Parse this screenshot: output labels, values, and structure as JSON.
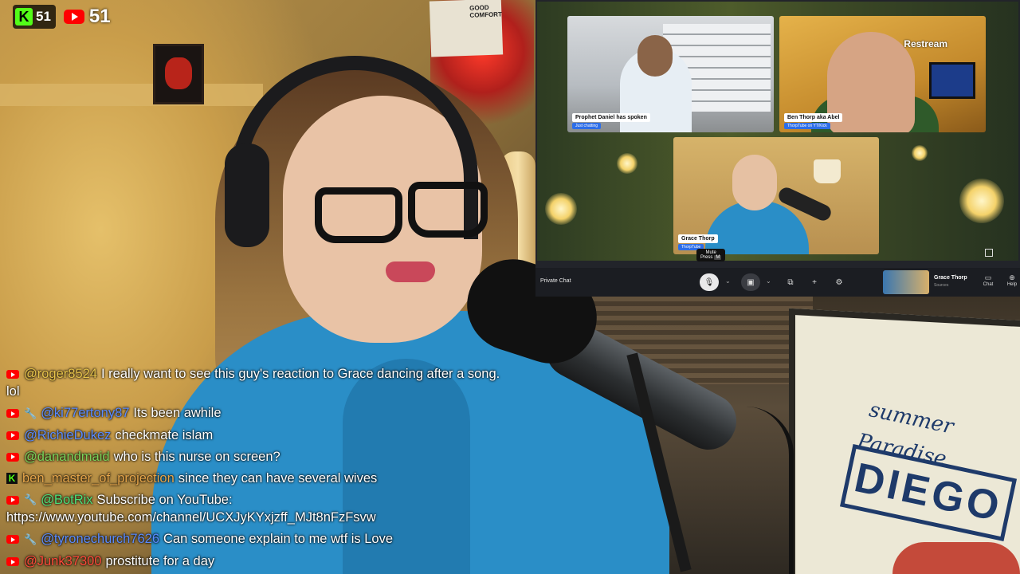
{
  "counters": {
    "kick": "51",
    "youtube": "51"
  },
  "colors": {
    "kick_green": "#53fc18",
    "youtube_red": "#ff0000",
    "hoodie": "#2a8ec7",
    "restream_bg": "#22242a"
  },
  "restream": {
    "logo": "Restream",
    "participants": [
      {
        "name": "Prophet Daniel has spoken",
        "sub": "Just chatting"
      },
      {
        "name": "Ben Thorp aka Abel",
        "sub": "ThorpTube on YT/Kick"
      },
      {
        "name": "Grace Thorp",
        "sub": "ThorpTube"
      }
    ],
    "tooltip": {
      "title": "Mute",
      "press": "Press",
      "key": "M"
    },
    "toolbar": {
      "private_chat": "Private Chat",
      "profile_name": "Grace Thorp",
      "profile_sub": "Sources",
      "chat_label": "Chat",
      "help_label": "Help"
    }
  },
  "sign": {
    "line1": "summer",
    "line2": "Paradise",
    "main": "DIEGO"
  },
  "chat": [
    {
      "platform": "youtube",
      "mod": false,
      "user": "@roger8524",
      "user_color": "#e7c34a",
      "text": "I really want to see this guy's reaction to Grace dancing after a song. lol"
    },
    {
      "platform": "youtube",
      "mod": true,
      "user": "@ki77ertony87",
      "user_color": "#5b8cff",
      "text": "Its been awhile"
    },
    {
      "platform": "youtube",
      "mod": false,
      "user": "@RichieDukez",
      "user_color": "#5b8cff",
      "text": "checkmate islam"
    },
    {
      "platform": "youtube",
      "mod": false,
      "user": "@danandmaid",
      "user_color": "#7ad35a",
      "text": "who is this nurse on screen?"
    },
    {
      "platform": "kick",
      "mod": false,
      "user": "ben_master_of_projection",
      "user_color": "#e7a64a",
      "text": "since they can have several wives"
    },
    {
      "platform": "youtube",
      "mod": true,
      "user": "@BotRix",
      "user_color": "#4de07a",
      "text": "Subscribe on YouTube: https://www.youtube.com/channel/UCXJyKYxjzff_MJt8nFzFsvw"
    },
    {
      "platform": "youtube",
      "mod": true,
      "user": "@tyronechurch7626",
      "user_color": "#5b8cff",
      "text": "Can someone explain to me wtf is Love"
    },
    {
      "platform": "youtube",
      "mod": false,
      "user": "@Junk37300",
      "user_color": "#ff4a3a",
      "text": "prostitute for a day"
    }
  ]
}
